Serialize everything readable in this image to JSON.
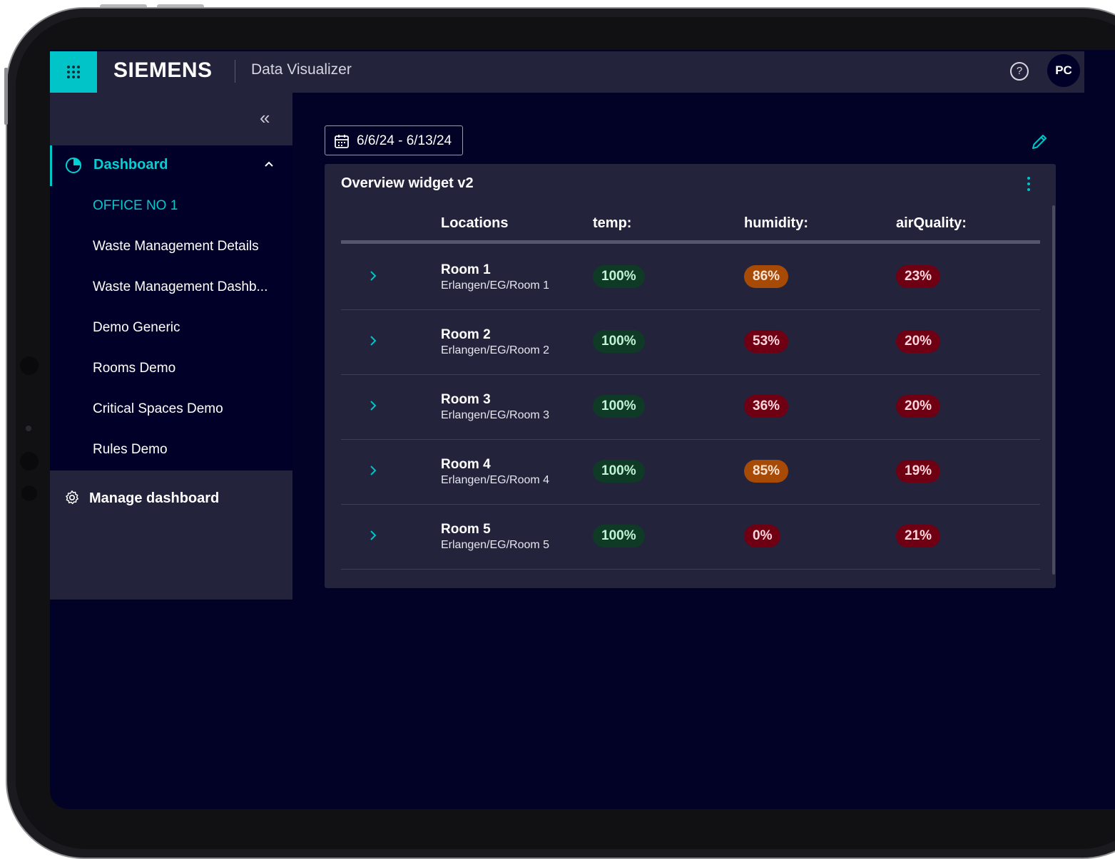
{
  "header": {
    "brand": "SIEMENS",
    "app_title": "Data Visualizer",
    "help_icon": "?",
    "avatar_initials": "PC"
  },
  "sidebar": {
    "collapse_icon": "«",
    "active_item": {
      "label": "Dashboard",
      "icon": "pie-chart-icon"
    },
    "sub_items": [
      {
        "label": "OFFICE NO 1",
        "active": true
      },
      {
        "label": "Waste Management Details",
        "active": false
      },
      {
        "label": "Waste Management Dashb...",
        "active": false
      },
      {
        "label": "Demo Generic",
        "active": false
      },
      {
        "label": "Rooms Demo",
        "active": false
      },
      {
        "label": "Critical Spaces Demo",
        "active": false
      },
      {
        "label": "Rules Demo",
        "active": false
      }
    ],
    "manage_label": "Manage dashboard"
  },
  "toolbar": {
    "date_range": "6/6/24 - 6/13/24"
  },
  "widget": {
    "title": "Overview widget v2",
    "columns": [
      "Locations",
      "temp:",
      "humidity:",
      "airQuality:"
    ],
    "rows": [
      {
        "name": "Room 1",
        "path": "Erlangen/EG/Room 1",
        "temp": "100%",
        "humidity": "86%",
        "airQuality": "23%",
        "humidity_status": "orange",
        "airQuality_status": "red"
      },
      {
        "name": "Room 2",
        "path": "Erlangen/EG/Room 2",
        "temp": "100%",
        "humidity": "53%",
        "airQuality": "20%",
        "humidity_status": "red",
        "airQuality_status": "red"
      },
      {
        "name": "Room 3",
        "path": "Erlangen/EG/Room 3",
        "temp": "100%",
        "humidity": "36%",
        "airQuality": "20%",
        "humidity_status": "red",
        "airQuality_status": "red"
      },
      {
        "name": "Room 4",
        "path": "Erlangen/EG/Room 4",
        "temp": "100%",
        "humidity": "85%",
        "airQuality": "19%",
        "humidity_status": "orange",
        "airQuality_status": "red"
      },
      {
        "name": "Room 5",
        "path": "Erlangen/EG/Room 5",
        "temp": "100%",
        "humidity": "0%",
        "airQuality": "21%",
        "humidity_status": "red",
        "airQuality_status": "red"
      }
    ]
  },
  "colors": {
    "accent": "#00c4c7",
    "good": "#0f3a26",
    "warning": "#a64a06",
    "bad": "#6f0014"
  }
}
